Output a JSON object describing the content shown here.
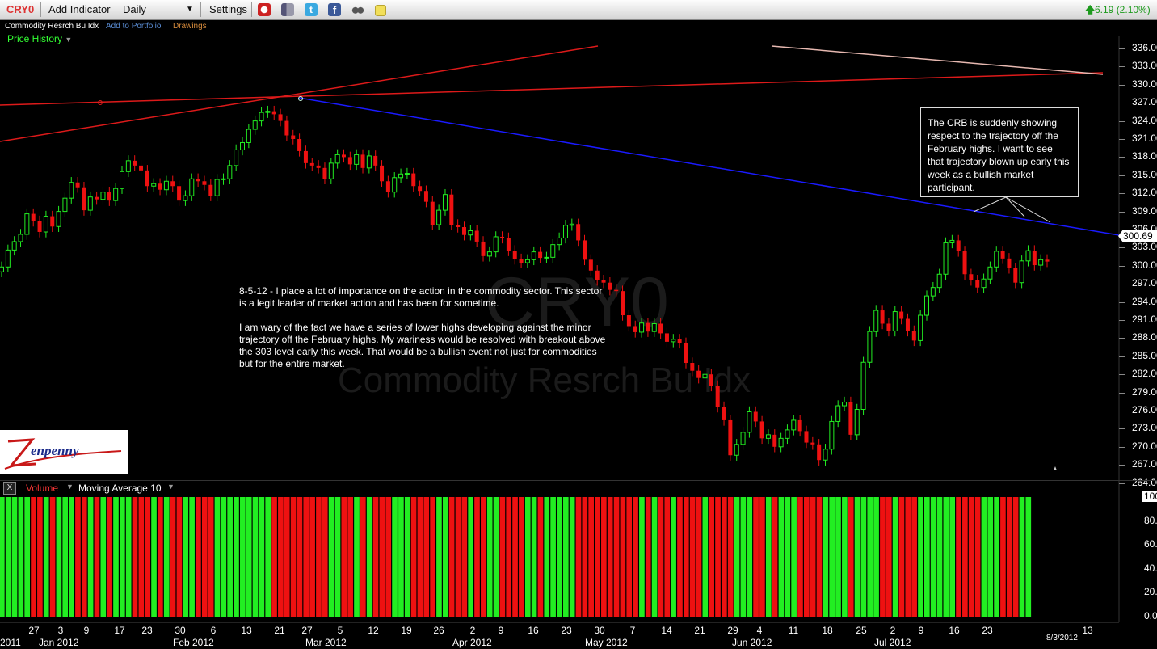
{
  "toolbar": {
    "symbol": "CRY0",
    "add_indicator": "Add Indicator",
    "period": "Daily",
    "settings": "Settings",
    "price_change": "6.19 (2.10%)",
    "icons": [
      "alarm-clock-icon",
      "book-icon",
      "twitter-icon",
      "facebook-icon",
      "binoculars-icon",
      "sticky-note-icon"
    ]
  },
  "subheader": {
    "name": "Commodity Resrch Bu Idx",
    "add_to_portfolio": "Add to Portfolio",
    "drawings": "Drawings",
    "price_history": "Price History"
  },
  "watermark": {
    "symbol": "CRY0",
    "name": "Commodity Resrch Bu Idx"
  },
  "annotations": {
    "left_note": "8-5-12 - I place a lot of importance on the action in the commodity sector. This sector is a legit leader of market action and has been for sometime.\n\nI am wary of the fact we have a series of lower highs developing against the minor trajectory off the February highs. My wariness would be resolved with breakout above the 303 level early this week. That would be a bullish event not just for commodities but for the entire market.",
    "right_note": "The CRB is suddenly showing respect to the trajectory off the February highs. I want to see that trajectory blown up early this week as a bullish market participant."
  },
  "logo": "Zenpenny",
  "price_axis": {
    "labels": [
      "336.00",
      "333.00",
      "330.00",
      "327.00",
      "324.00",
      "321.00",
      "318.00",
      "315.00",
      "312.00",
      "309.00",
      "306.00",
      "303.00",
      "300.00",
      "297.00",
      "294.00",
      "291.00",
      "288.00",
      "285.00",
      "282.00",
      "279.00",
      "276.00",
      "273.00",
      "270.00",
      "267.00",
      "264.00"
    ],
    "current": "300.69"
  },
  "volume_panel": {
    "close_label": "X",
    "title": "Volume",
    "indicator": "Moving Average 10",
    "axis_labels": [
      "100.00",
      "80.00",
      "60.00",
      "40.00",
      "20.00",
      "0.00"
    ]
  },
  "x_axis": {
    "days": [
      "27",
      "3",
      "9",
      "17",
      "23",
      "30",
      "6",
      "13",
      "21",
      "27",
      "5",
      "12",
      "19",
      "26",
      "2",
      "9",
      "16",
      "23",
      "30",
      "7",
      "14",
      "21",
      "29",
      "4",
      "11",
      "18",
      "25",
      "2",
      "9",
      "16",
      "23",
      "13"
    ],
    "months": [
      "2011",
      "Jan 2012",
      "Feb 2012",
      "Mar 2012",
      "Apr 2012",
      "May 2012",
      "Jun 2012",
      "Jul 2012"
    ],
    "date_marker": "8/3/2012"
  },
  "colors": {
    "up": "#22ee22",
    "down": "#ee1111",
    "trend_blue": "#1a1aff",
    "trend_red": "#dd1a1a",
    "accent_green": "#33ff33"
  },
  "chart_data": {
    "type": "candlestick",
    "ylim": [
      262.5,
      337.5
    ],
    "x": [
      "2011-12-27",
      "2011-12-28",
      "2011-12-29",
      "2011-12-30",
      "2012-01-03",
      "2012-01-04",
      "2012-01-05",
      "2012-01-06",
      "2012-01-09",
      "2012-01-10",
      "2012-01-11",
      "2012-01-12",
      "2012-01-13",
      "2012-01-17",
      "2012-01-18",
      "2012-01-19",
      "2012-01-20",
      "2012-01-23",
      "2012-01-24",
      "2012-01-25",
      "2012-01-26",
      "2012-01-27",
      "2012-01-30",
      "2012-01-31",
      "2012-02-01",
      "2012-02-02",
      "2012-02-03",
      "2012-02-06",
      "2012-02-07",
      "2012-02-08",
      "2012-02-09",
      "2012-02-10",
      "2012-02-13",
      "2012-02-14",
      "2012-02-15",
      "2012-02-16",
      "2012-02-17",
      "2012-02-21",
      "2012-02-22",
      "2012-02-23",
      "2012-02-24",
      "2012-02-27",
      "2012-02-28",
      "2012-02-29",
      "2012-03-01",
      "2012-03-02",
      "2012-03-05",
      "2012-03-06",
      "2012-03-07",
      "2012-03-08",
      "2012-03-09",
      "2012-03-12",
      "2012-03-13",
      "2012-03-14",
      "2012-03-15",
      "2012-03-16",
      "2012-03-19",
      "2012-03-20",
      "2012-03-21",
      "2012-03-22",
      "2012-03-23",
      "2012-03-26",
      "2012-03-27",
      "2012-03-28",
      "2012-03-29",
      "2012-03-30",
      "2012-04-02",
      "2012-04-03",
      "2012-04-04",
      "2012-04-05",
      "2012-04-09",
      "2012-04-10",
      "2012-04-11",
      "2012-04-12",
      "2012-04-13",
      "2012-04-16",
      "2012-04-17",
      "2012-04-18",
      "2012-04-19",
      "2012-04-20",
      "2012-04-23",
      "2012-04-24",
      "2012-04-25",
      "2012-04-26",
      "2012-04-27",
      "2012-04-30",
      "2012-05-01",
      "2012-05-02",
      "2012-05-03",
      "2012-05-04",
      "2012-05-07",
      "2012-05-08",
      "2012-05-09",
      "2012-05-10",
      "2012-05-11",
      "2012-05-14",
      "2012-05-15",
      "2012-05-16",
      "2012-05-17",
      "2012-05-18",
      "2012-05-21",
      "2012-05-22",
      "2012-05-23",
      "2012-05-24",
      "2012-05-25",
      "2012-05-29",
      "2012-05-30",
      "2012-05-31",
      "2012-06-01",
      "2012-06-04",
      "2012-06-05",
      "2012-06-06",
      "2012-06-07",
      "2012-06-08",
      "2012-06-11",
      "2012-06-12",
      "2012-06-13",
      "2012-06-14",
      "2012-06-15",
      "2012-06-18",
      "2012-06-19",
      "2012-06-20",
      "2012-06-21",
      "2012-06-22",
      "2012-06-25",
      "2012-06-26",
      "2012-06-27",
      "2012-06-28",
      "2012-06-29",
      "2012-07-02",
      "2012-07-03",
      "2012-07-05",
      "2012-07-06",
      "2012-07-09",
      "2012-07-10",
      "2012-07-11",
      "2012-07-12",
      "2012-07-13",
      "2012-07-16",
      "2012-07-17",
      "2012-07-18",
      "2012-07-19",
      "2012-07-20",
      "2012-07-23",
      "2012-07-24",
      "2012-07-25",
      "2012-07-26",
      "2012-07-27",
      "2012-07-30",
      "2012-07-31",
      "2012-08-01",
      "2012-08-02",
      "2012-08-03"
    ],
    "close": [
      299.8,
      302.6,
      304.0,
      305.2,
      308.6,
      307.4,
      305.6,
      308.2,
      306.5,
      309.0,
      311.2,
      313.8,
      313.0,
      309.2,
      311.4,
      311.0,
      312.2,
      310.8,
      312.8,
      315.6,
      317.4,
      316.6,
      315.8,
      313.2,
      313.6,
      312.6,
      314.0,
      313.2,
      310.8,
      311.6,
      314.4,
      314.0,
      313.4,
      311.6,
      314.3,
      314.4,
      316.6,
      319.2,
      320.4,
      322.6,
      324.0,
      325.4,
      325.6,
      325.1,
      324.0,
      321.6,
      321.0,
      319.0,
      317.0,
      316.6,
      316.2,
      314.4,
      317.0,
      318.4,
      318.0,
      316.8,
      318.4,
      316.2,
      318.2,
      316.6,
      314.0,
      312.2,
      314.6,
      315.2,
      315.3,
      313.2,
      312.4,
      310.6,
      306.8,
      309.2,
      311.8,
      306.8,
      306.4,
      305.1,
      305.8,
      304.0,
      301.6,
      302.3,
      304.8,
      304.6,
      302.5,
      301.1,
      300.5,
      301.0,
      302.3,
      301.3,
      301.4,
      303.5,
      304.6,
      306.7,
      306.9,
      304.2,
      301.0,
      299.2,
      297.6,
      297.2,
      296.0,
      295.8,
      291.8,
      290.0,
      289.0,
      290.5,
      289.1,
      290.4,
      288.8,
      287.4,
      287.8,
      287.2,
      283.9,
      282.6,
      281.4,
      282.0,
      280.1,
      276.6,
      274.4,
      268.6,
      270.4,
      272.4,
      275.8,
      274.2,
      271.4,
      272.0,
      270.0,
      271.4,
      272.8,
      274.4,
      272.6,
      270.7,
      270.4,
      267.8,
      269.6,
      274.2,
      276.8,
      277.4,
      272.0,
      276.2,
      284.0,
      289.1,
      292.6,
      290.4,
      289.2,
      292.4,
      291.2,
      289.2,
      287.6,
      291.8,
      295.0,
      296.4,
      298.6,
      303.8,
      304.2,
      302.4,
      298.6,
      297.6,
      296.4,
      297.8,
      299.8,
      302.4,
      301.2,
      299.6,
      297.2,
      300.8,
      302.5,
      300.1,
      301.0,
      300.69
    ],
    "volume_pct": [
      100,
      100,
      100,
      100,
      100,
      100,
      100,
      100,
      100,
      100,
      100,
      100,
      100,
      100,
      100,
      100,
      100,
      100,
      100,
      100,
      100,
      100,
      100,
      100,
      100,
      100,
      100,
      100,
      100,
      100,
      100,
      100,
      100,
      100,
      100,
      100,
      100,
      100,
      100,
      100,
      100,
      100,
      100,
      100,
      100,
      100,
      100,
      100,
      100,
      100,
      100,
      100,
      100,
      100,
      100,
      100,
      100,
      100,
      100,
      100,
      100,
      100,
      100,
      100,
      100,
      100,
      100,
      100,
      100,
      100,
      100,
      100,
      100,
      100,
      100,
      100,
      100,
      100,
      100,
      100,
      100,
      100,
      100,
      100,
      100,
      100,
      100,
      100,
      100,
      100,
      100,
      100,
      100,
      100,
      100,
      100,
      100,
      100,
      100,
      100,
      100,
      100,
      100,
      100,
      100,
      100,
      100,
      100,
      100,
      100,
      100,
      100,
      100,
      100,
      100,
      100,
      100,
      100,
      100,
      100,
      100,
      100,
      100,
      100,
      100,
      100,
      100,
      100,
      100,
      100,
      100,
      100,
      100,
      100,
      100,
      100,
      100,
      100,
      100,
      100,
      100,
      100,
      100,
      100,
      100,
      100,
      100,
      100,
      100,
      100,
      100,
      100,
      100,
      100,
      100,
      100,
      100,
      100,
      100,
      100,
      100,
      100,
      100
    ]
  }
}
